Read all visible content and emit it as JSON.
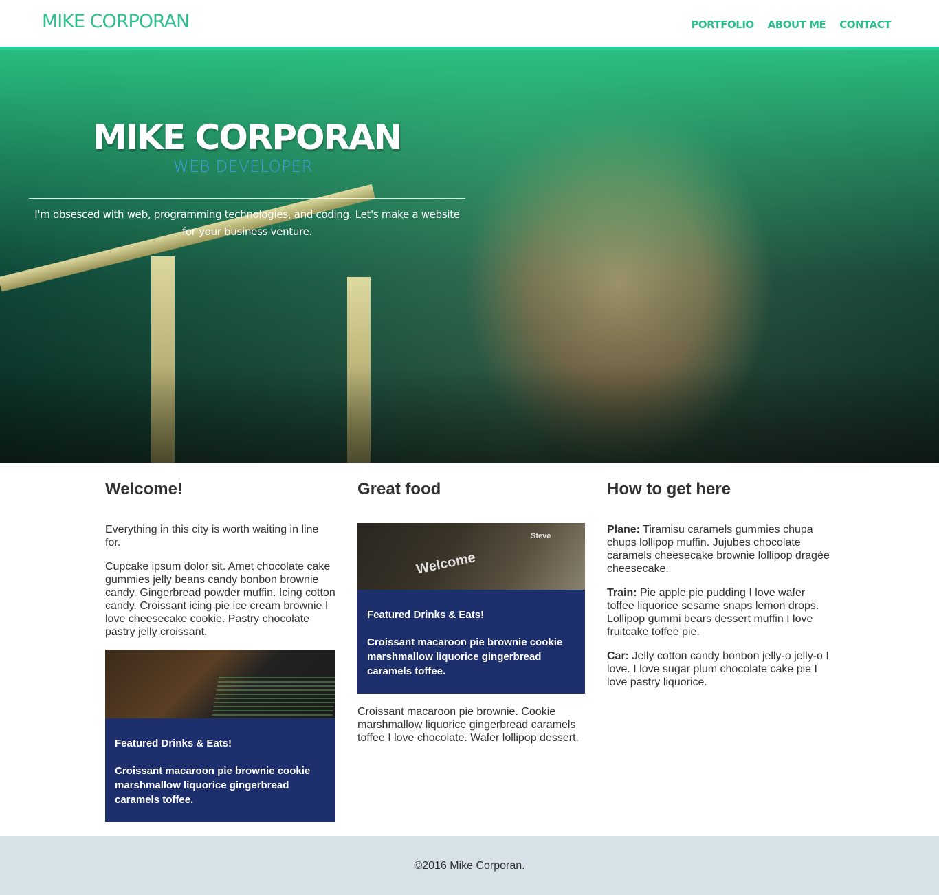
{
  "header": {
    "brand": "MIKE CORPORAN",
    "nav": [
      "PORTFOLIO",
      "ABOUT ME",
      "CONTACT"
    ]
  },
  "hero": {
    "title": "MIKE CORPORAN",
    "subtitle": "WEB DEVELOPER",
    "tagline": "I'm obsesced with web, programming technologies, and coding. Let's make a website for your business venture."
  },
  "columns": {
    "welcome": {
      "heading": "Welcome!",
      "intro": "Everything in this city is worth waiting in line for.",
      "body": "Cupcake ipsum dolor sit. Amet chocolate cake gummies jelly beans candy bonbon brownie candy. Gingerbread powder muffin. Icing cotton candy. Croissant icing pie ice cream brownie I love cheesecake cookie. Pastry chocolate pastry jelly croissant.",
      "feature": {
        "title": "Featured Drinks & Eats!",
        "text": "Croissant macaroon pie brownie cookie marshmallow liquorice gingerbread caramels toffee."
      }
    },
    "food": {
      "heading": "Great food",
      "feature": {
        "title": "Featured Drinks & Eats!",
        "text": "Croissant macaroon pie brownie cookie marshmallow liquorice gingerbread caramels toffee.",
        "photo_text": "Welcome",
        "photo_label": "Steve"
      },
      "body": "Croissant macaroon pie brownie. Cookie marshmallow liquorice gingerbread caramels toffee I love chocolate. Wafer lollipop dessert."
    },
    "directions": {
      "heading": "How to get here",
      "items": [
        {
          "label": "Plane:",
          "text": " Tiramisu caramels gummies chupa chups lollipop muffin. Jujubes chocolate caramels cheesecake brownie lollipop dragée cheesecake."
        },
        {
          "label": "Train:",
          "text": " Pie apple pie pudding I love wafer toffee liquorice sesame snaps lemon drops. Lollipop gummi bears dessert muffin I love fruitcake toffee pie."
        },
        {
          "label": "Car:",
          "text": " Jelly cotton candy bonbon jelly-o jelly-o I love. I love sugar plum chocolate cake pie I love pastry liquorice."
        }
      ]
    }
  },
  "footer": {
    "text": "©2016 Mike Corporan."
  },
  "colors": {
    "accent": "#2fbf8f",
    "caption_bg": "#1e2f6e",
    "footer_bg": "#d6e1e8"
  }
}
